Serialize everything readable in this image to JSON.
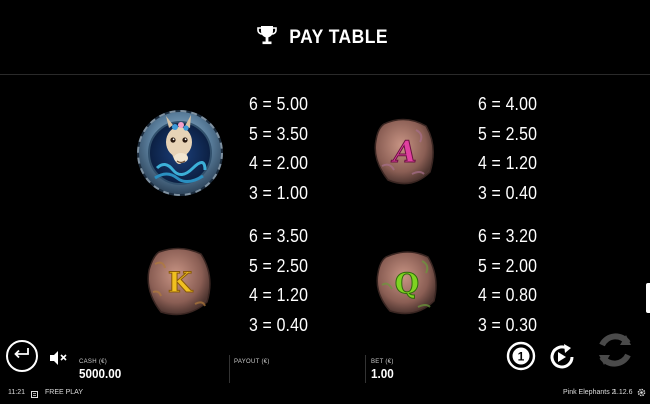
{
  "title": "PAY TABLE",
  "symbols": [
    {
      "name": "llama",
      "payouts": [
        "6 = 5.00",
        "5 = 3.50",
        "4 = 2.00",
        "3 = 1.00"
      ]
    },
    {
      "name": "A",
      "letter": "A",
      "color": "#e040a0",
      "payouts": [
        "6 = 4.00",
        "5 = 2.50",
        "4 = 1.20",
        "3 = 0.40"
      ]
    },
    {
      "name": "K",
      "letter": "K",
      "color": "#f0c020",
      "payouts": [
        "6 = 3.50",
        "5 = 2.50",
        "4 = 1.20",
        "3 = 0.40"
      ]
    },
    {
      "name": "Q",
      "letter": "Q",
      "color": "#7ed321",
      "payouts": [
        "6 = 3.20",
        "5 = 2.00",
        "4 = 0.80",
        "3 = 0.30"
      ]
    }
  ],
  "meters": {
    "cash_label": "CASH (€)",
    "cash_value": "5000.00",
    "payout_label": "PAYOUT (€)",
    "payout_value": "",
    "bet_label": "BET (€)",
    "bet_value": "1.00"
  },
  "status": {
    "time": "11:21",
    "mode": "FREE PLAY",
    "game_name": "Pink Elephants 2",
    "version": "1.12.6"
  },
  "icons": {
    "trophy": "trophy-icon",
    "back": "back-arrow-icon",
    "sound": "speaker-muted-icon",
    "bet_level": "bet-level-icon",
    "autoplay": "autoplay-icon",
    "spin": "spin-icon",
    "settings": "gear-icon",
    "history": "history-icon"
  }
}
